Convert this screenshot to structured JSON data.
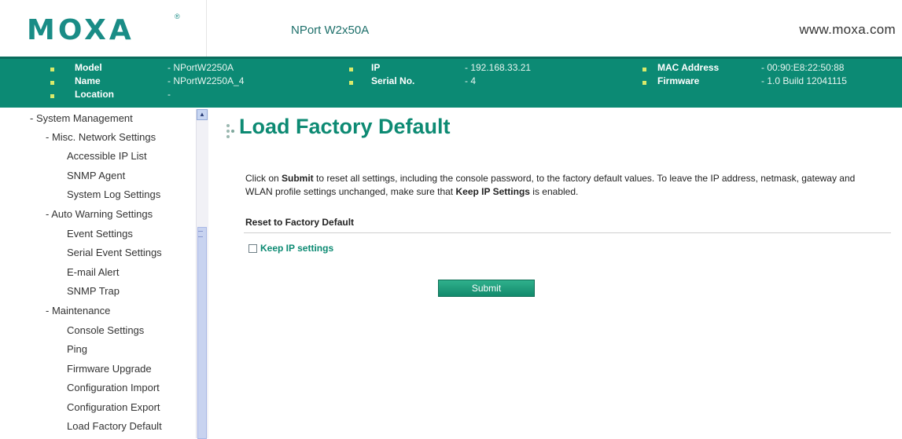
{
  "header": {
    "logo": "MOXA",
    "logo_reg": "®",
    "product": "NPort W2x50A",
    "url": "www.moxa.com"
  },
  "info": {
    "model_label": "Model",
    "model_value": "- NPortW2250A",
    "name_label": "Name",
    "name_value": "- NPortW2250A_4",
    "location_label": "Location",
    "location_value": "-",
    "ip_label": "IP",
    "ip_value": "- 192.168.33.21",
    "serial_label": "Serial No.",
    "serial_value": "- 4",
    "mac_label": "MAC Address",
    "mac_value": "- 00:90:E8:22:50:88",
    "firmware_label": "Firmware",
    "firmware_value": "- 1.0 Build 12041115"
  },
  "sidebar": {
    "items": [
      "- System Management",
      "- Misc. Network Settings",
      "Accessible IP List",
      "SNMP Agent",
      "System Log Settings",
      "- Auto Warning Settings",
      "Event Settings",
      "Serial Event Settings",
      "E-mail Alert",
      "SNMP Trap",
      "- Maintenance",
      "Console Settings",
      "Ping",
      "Firmware Upgrade",
      "Configuration Import",
      "Configuration Export",
      "Load Factory Default"
    ]
  },
  "main": {
    "title": "Load Factory Default",
    "desc_1": "Click on ",
    "desc_submit": "Submit",
    "desc_2": " to reset all settings, including the console password, to the factory default values. To leave the IP address, netmask, gateway and WLAN profile settings unchanged, make sure that ",
    "desc_keep": "Keep IP Settings",
    "desc_3": " is enabled.",
    "section_header": "Reset to Factory Default",
    "keep_ip_label": "Keep IP settings",
    "keep_ip_checked": false,
    "submit_label": "Submit"
  },
  "colors": {
    "brand": "#1a8c86",
    "info_bar": "#0c8a74",
    "title": "#0d8a73",
    "button": "#138a6c"
  }
}
